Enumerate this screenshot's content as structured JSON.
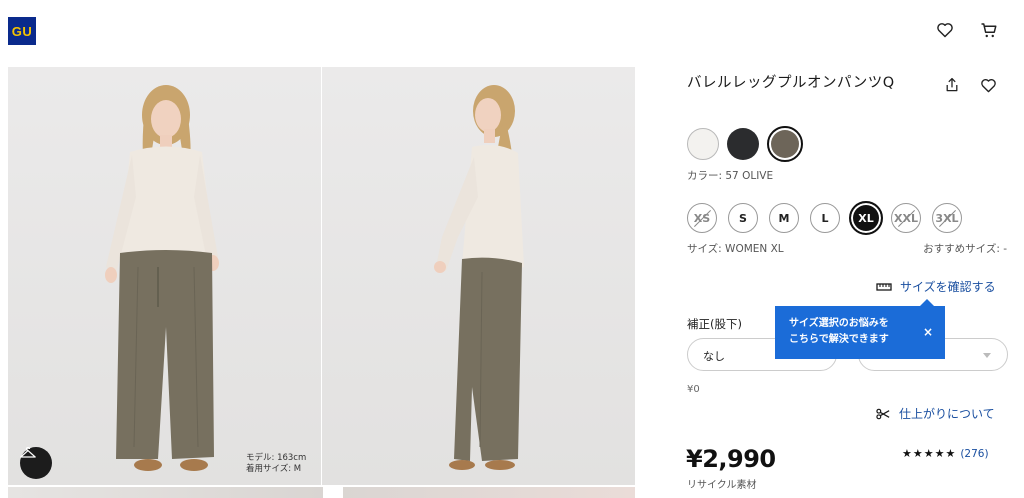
{
  "header": {
    "logo_text": "GU",
    "icons": [
      "heart-icon",
      "cart-icon"
    ]
  },
  "gallery": {
    "model_caption_line1": "モデル: 163cm",
    "model_caption_line2": "着用サイズ: M"
  },
  "product": {
    "title": "バレルレッグプルオンパンツQ",
    "colors": [
      {
        "name": "white",
        "hex": "#f3f2ef"
      },
      {
        "name": "black",
        "hex": "#2b2c2e"
      },
      {
        "name": "olive",
        "hex": "#6d6559",
        "selected": true
      }
    ],
    "color_label": "カラー: 57 OLIVE",
    "sizes": [
      {
        "label": "XS",
        "available": false
      },
      {
        "label": "S",
        "available": true
      },
      {
        "label": "M",
        "available": true
      },
      {
        "label": "L",
        "available": true
      },
      {
        "label": "XL",
        "available": true,
        "selected": true
      },
      {
        "label": "XXL",
        "available": false
      },
      {
        "label": "3XL",
        "available": false
      }
    ],
    "size_label": "サイズ: WOMEN XL",
    "recommended_label": "おすすめサイズ: -",
    "size_check_link": "サイズを確認する",
    "tooltip_line1": "サイズ選択のお悩みを",
    "tooltip_line2": "こちらで解決できます",
    "tooltip_close": "×",
    "hem_label": "補正(股下)",
    "hem_select_value": "なし",
    "hem_price": "¥0",
    "finish_link": "仕上がりについて",
    "price": "¥2,990",
    "recycle_label": "リサイクル素材",
    "rating_stars": "★★★★★",
    "rating_value": 4.5,
    "review_count": "(276)"
  },
  "colors": {
    "link": "#1a4fa0",
    "tooltip": "#1b6cd8",
    "logo_bg": "#0a2a8c",
    "logo_text": "#f5c400"
  }
}
